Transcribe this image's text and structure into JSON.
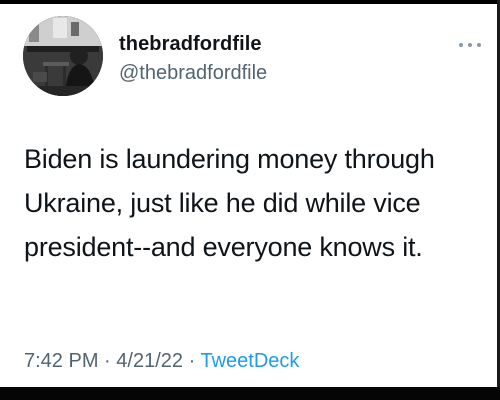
{
  "tweet": {
    "display_name": "thebradfordfile",
    "handle": "@thebradfordfile",
    "text": "Biden is laundering money through Ukraine, just like he did while vice president--and everyone knows it.",
    "time": "7:42 PM",
    "separator": "·",
    "date": "4/21/22",
    "source": "TweetDeck"
  },
  "icons": {
    "more": "more-horizontal-icon",
    "avatar": "avatar-photo"
  },
  "colors": {
    "text": "#0f1419",
    "secondary": "#536471",
    "link": "#1d9bf0"
  }
}
